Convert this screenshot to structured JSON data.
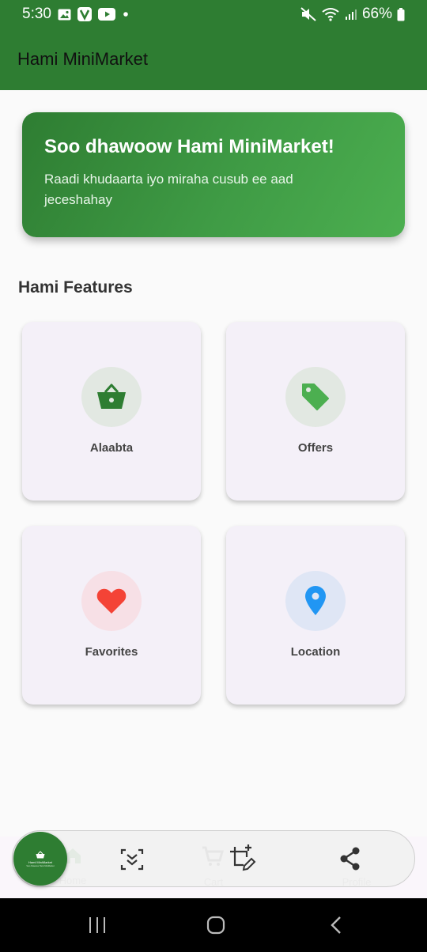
{
  "status_bar": {
    "time": "5:30",
    "battery": "66%",
    "left_icons": [
      "gallery-icon",
      "v-app-icon",
      "youtube-icon",
      "dot-icon"
    ],
    "right_icons": [
      "mute-icon",
      "wifi-icon",
      "signal-icon",
      "battery-icon"
    ]
  },
  "app_bar": {
    "title": "Hami MiniMarket"
  },
  "banner": {
    "title": "Soo dhawoow Hami MiniMarket!",
    "subtitle": "Raadi khudaarta iyo miraha cusub ee aad jeceshahay"
  },
  "features": {
    "title": "Hami Features",
    "items": [
      {
        "label": "Alaabta",
        "icon": "basket-icon",
        "color": "#2e7d32",
        "bg": "#e2e8e2"
      },
      {
        "label": "Offers",
        "icon": "tag-icon",
        "color": "#4caf50",
        "bg": "#e2e8e2"
      },
      {
        "label": "Favorites",
        "icon": "heart-icon",
        "color": "#f44336",
        "bg": "#f7e0e6"
      },
      {
        "label": "Location",
        "icon": "location-pin-icon",
        "color": "#2196f3",
        "bg": "#dfe6f5"
      }
    ]
  },
  "bottom_nav": {
    "items": [
      {
        "label": "Home",
        "icon": "home-icon"
      },
      {
        "label": "Cart",
        "icon": "cart-icon"
      },
      {
        "label": "Profile",
        "icon": "profile-icon"
      }
    ]
  },
  "floating_toolbar": {
    "preview_title": "Hami MiniMarket",
    "preview_subtitle": "Soo dhawoow Hami MiniMarket",
    "tools": [
      "scroll-capture-icon",
      "crop-edit-icon",
      "share-icon"
    ]
  },
  "colors": {
    "primary": "#2e7d32",
    "primary_light": "#4caf50",
    "card_bg": "#f4f0f8"
  }
}
